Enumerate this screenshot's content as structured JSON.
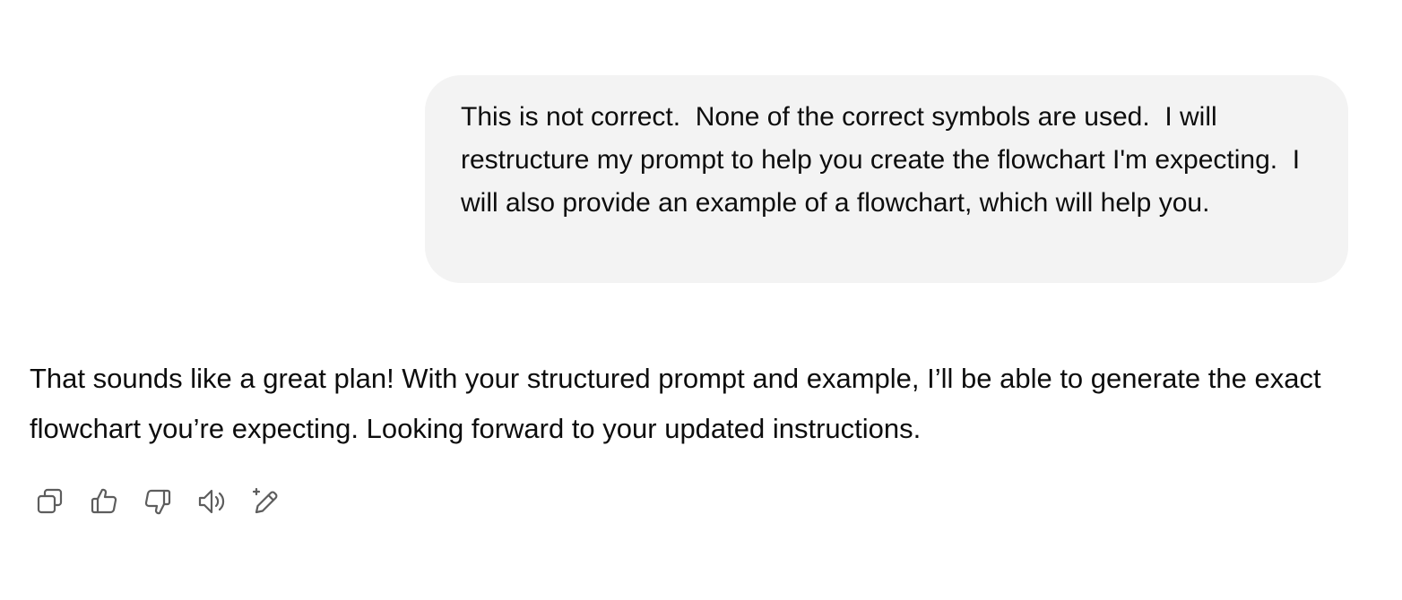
{
  "conversation": {
    "user_message": "This is not correct.  None of the correct symbols are used.  I will restructure my prompt to help you create the flowchart I'm expecting.  I will also provide an example of a flowchart, which will help you.",
    "assistant_message": "That sounds like a great plan! With your structured prompt and example, I’ll be able to generate the exact flowchart you’re expecting. Looking forward to your updated instructions."
  },
  "actions": [
    {
      "name": "copy",
      "icon": "copy-icon"
    },
    {
      "name": "good-response",
      "icon": "thumbs-up-icon"
    },
    {
      "name": "bad-response",
      "icon": "thumbs-down-icon"
    },
    {
      "name": "read-aloud",
      "icon": "speaker-icon"
    },
    {
      "name": "edit-in-canvas",
      "icon": "pencil-sparkle-icon"
    }
  ],
  "colors": {
    "user_bubble_bg": "#f3f3f3",
    "text": "#0d0d0d",
    "icon": "#5d5d5d"
  }
}
